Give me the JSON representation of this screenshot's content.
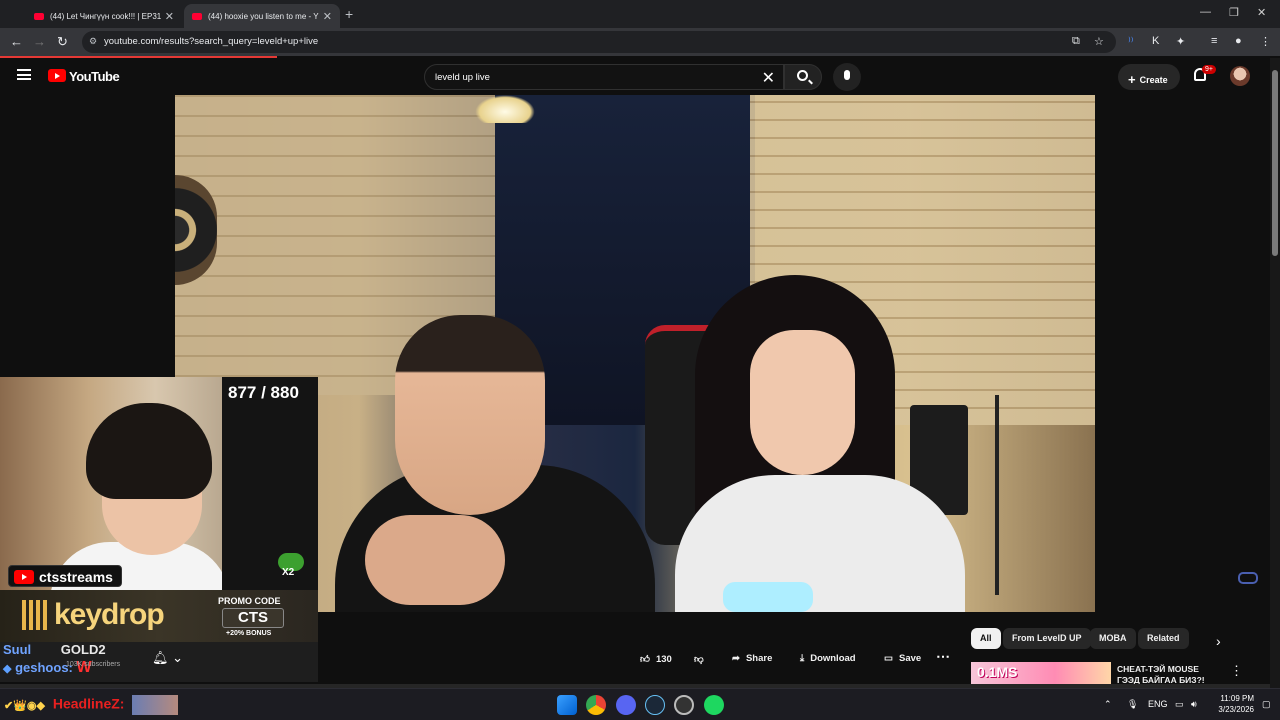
{
  "browser": {
    "tabs": [
      {
        "title": "(44) Let Чингүүн cook!!! | EP31",
        "active": false
      },
      {
        "title": "(44) hooxie you listen to me - Y",
        "active": true
      }
    ],
    "new_tab": "+",
    "url": "youtube.com/results?search_query=leveld+up+live"
  },
  "youtube": {
    "logo_text": "YouTube",
    "search_value": "leveld up live",
    "create_label": "Create",
    "notification_count": "9+"
  },
  "overlay": {
    "view_count": "877 / 880",
    "channel_tag": "ctsstreams",
    "sponsor": "keydrop",
    "promo_label": "PROMO CODE",
    "promo_code": "CTS",
    "promo_bonus": "+20% BONUS",
    "chat_user_1": "Suul",
    "chat_msg_1": "GOLD2",
    "chat_user_2": "geshoos:",
    "chat_msg_2": "W",
    "subscribers": "103K subscribers",
    "multiplier": "X2"
  },
  "video_actions": {
    "like_count": "130",
    "share_label": "Share",
    "download_label": "Download",
    "save_label": "Save"
  },
  "chips": [
    "All",
    "From LevelD UP",
    "MOBA",
    "Related"
  ],
  "related": {
    "thumb_text": "0.1MS",
    "title": "CHEAT-ТЭЙ MOUSE ГЭЭД БАЙГАА БИЗ?!"
  },
  "taskbar": {
    "chat_name": "HeadlineZ:",
    "language": "ENG",
    "time": "11:09 PM",
    "date": "3/23/2026"
  },
  "colors": {
    "accent": "#ff0000",
    "background": "#0f0f0f",
    "notification": "#cc0000"
  }
}
